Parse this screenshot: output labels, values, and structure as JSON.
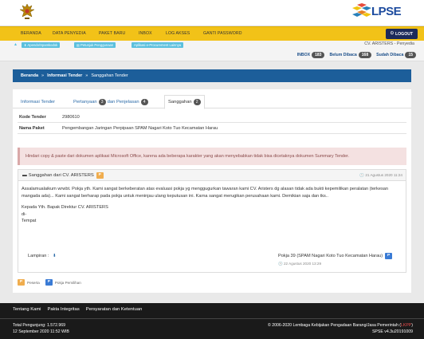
{
  "header": {
    "logo_text": "LPSE"
  },
  "nav": {
    "items": [
      "BERANDA",
      "DATA PENYEDIA",
      "PAKET BARU",
      "INBOX",
      "LOG AKSES",
      "GANTI PASSWORD"
    ],
    "logout_label": "LOGOUT"
  },
  "subbar": {
    "buttons": [
      "Apendo/Spamkodok",
      "Petunjuk Penggunaan",
      "Aplikasi e-Procurement Lainnya"
    ],
    "vendor": "CV. ARISTERS - Penyedia",
    "inbox": {
      "label": "INBOX",
      "count": "183"
    },
    "unread": {
      "label": "Belum Dibaca",
      "count": "168"
    },
    "read": {
      "label": "Sudah Dibaca",
      "count": "15"
    }
  },
  "breadcrumb": {
    "home": "Beranda",
    "info": "Informasi Tender",
    "current": "Sanggahan Tender"
  },
  "tabs": [
    {
      "label": "Informasi Tender"
    },
    {
      "label_pre": "Pertanyaan",
      "count": "3",
      "label_post": "dan Penjelasan",
      "count2": "4"
    },
    {
      "label": "Sanggahan",
      "count": "2"
    }
  ],
  "info": {
    "kode_label": "Kode Tender",
    "kode_value": "2980610",
    "paket_label": "Nama Paket",
    "paket_value": "Pengembangan Jaringan Perpipaan SPAM Nagari Koto Tuo Kecamatan Harau"
  },
  "warning": "Hindari copy & paste dari dokumen aplikasi Microsoft Office, karena ada beberapa karakter yang akan menyebabkan tidak bisa dicetaknya dokumen Summary Tender.",
  "message": {
    "title": "Sanggahan dari CV. ARISTERS",
    "badge": "P",
    "date": "21 Agustus 2020 11:24",
    "body": "Assalamualaikum wrwbt. Pokja yth. Kami sangat berkeberatan atas evaluasi pokja yg menggugurkan tawaran kami CV. Aristers dg alasan tidak ada bukti kepemilikan peralatan (terkesan mangada ada)... Kami sangat berharap pada pokja untuk meninjau ulang keputusan ini. Karna sangat merugikan perusahaan kami. Demikian saja dan tks..",
    "to_line1": "Kepada Yth. Bapak Direktur CV. ARISTERS",
    "to_line2": "di-",
    "to_line3": "Tempat",
    "attachment_label": "Lampiran :",
    "reply_from": "Pokja 39 (SPAM Nagari Koto Tuo Kecamatan Harau)",
    "reply_badge": "P",
    "reply_date": "22 Agustus 2020 13:29"
  },
  "legend": {
    "peserta_badge": "P",
    "peserta": "Peserta",
    "pokja_badge": "P",
    "pokja": "Pokja Pemilihan"
  },
  "footer": {
    "links": [
      "Tentang Kami",
      "Pakta Integritas",
      "Persyaratan dan Ketentuan"
    ],
    "visitors": "Total Pengunjung: 1.572.969",
    "datetime": "12 September 2020 11:52 WIB",
    "copyright": "© 2006-2020 Lembaga Kebijakan Pengadaan Barang/Jasa Pemerintah (",
    "lkpp": "LKPP",
    "copyright_end": ")",
    "version": "SPSE v4.3u20191009"
  },
  "colors": {
    "nav_yellow": "#f2c218",
    "breadcrumb_blue": "#1c5e9a",
    "logout_navy": "#1c2a5a",
    "footer_black": "#1a1a1a"
  }
}
